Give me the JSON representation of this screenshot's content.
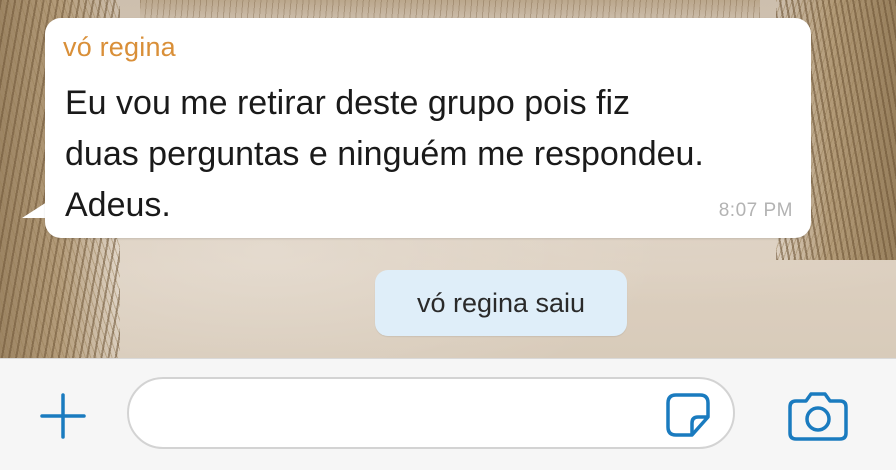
{
  "message": {
    "sender": "vó regina",
    "text": "Eu vou me retirar deste grupo pois fiz\nduas perguntas e ninguém me respondeu.\nAdeus.",
    "time": "8:07 PM"
  },
  "system_notice": {
    "text": "vó regina saiu"
  },
  "input_bar": {
    "value": "",
    "icons": [
      "plus-icon",
      "sticker-icon",
      "camera-icon"
    ]
  },
  "colors": {
    "sender_name": "#d98f38",
    "accent": "#1a7bbf",
    "system_notice_bg": "#dfeef9",
    "bubble_bg": "#ffffff",
    "timestamp": "#b3b3b3"
  }
}
